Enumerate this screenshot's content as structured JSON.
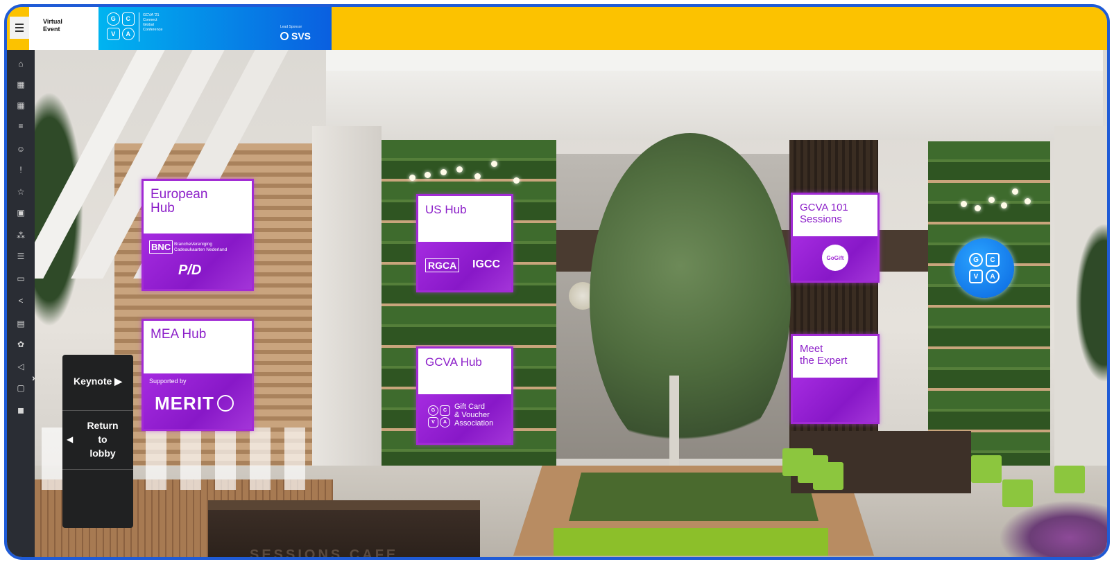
{
  "header": {
    "event_title": "Virtual\nEvent",
    "banner": {
      "logo_letters": [
        "G",
        "C",
        "V",
        "A"
      ],
      "conference_text": "GCVA '21\nConnect\nGlobal\nConference",
      "sponsor_label": "Lead Sponsor",
      "sponsor_name": "SVS"
    }
  },
  "sidebar": {
    "icons": [
      "home-icon",
      "calendar-icon",
      "calendar-alt-icon",
      "list-icon",
      "people-icon",
      "info-icon",
      "star-icon",
      "camera-icon",
      "network-icon",
      "list-bullet-icon",
      "video-icon",
      "share-icon",
      "poll-icon",
      "group-icon",
      "megaphone-icon",
      "chat-icon",
      "profile-icon"
    ],
    "toggle": "›"
  },
  "signs": {
    "european_hub": {
      "title": "European\nHub",
      "sponsor1": "BrancheVereniging\nCadeaukaarten Nederland",
      "sponsor1_logo": "BNC",
      "sponsor2_logo": "P/D"
    },
    "us_hub": {
      "title": "US Hub",
      "sponsor1_logo": "RGCA",
      "sponsor2_logo": "IGCC"
    },
    "gcva_101": {
      "title": "GCVA 101\nSessions",
      "sponsor_logo": "GoGift"
    },
    "mea_hub": {
      "title": "MEA Hub",
      "supported_by": "Supported by",
      "sponsor_logo": "MERIT"
    },
    "gcva_hub": {
      "title": "GCVA Hub",
      "association": "Gift Card\n& Voucher\nAssociation",
      "logo_letters": [
        "G",
        "C",
        "V",
        "A"
      ]
    },
    "meet_expert": {
      "title": "Meet\nthe Expert"
    }
  },
  "directory": {
    "keynote": "Keynote ▶",
    "return_lobby": "Return\nto\nlobby",
    "return_arrow": "◀"
  },
  "scene": {
    "gcva_logo_letters": [
      "G",
      "C",
      "V",
      "A"
    ],
    "counter_text": "SESSIONS CAFE"
  }
}
